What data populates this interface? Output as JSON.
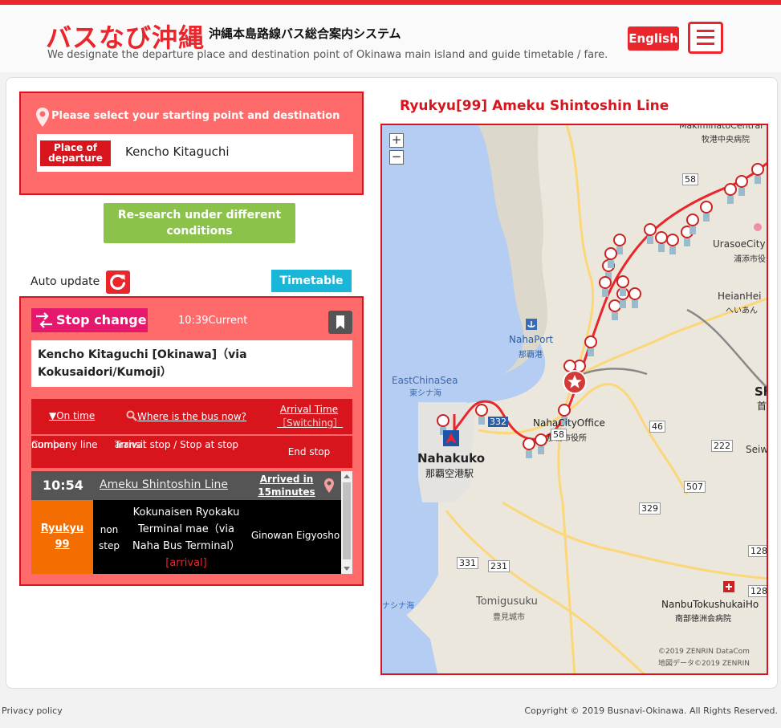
{
  "header": {
    "logo": "バスなび沖縄",
    "subtitle": "沖縄本島路線バス総合案内システム",
    "tagline": "We designate the departure place and destination point of Okinawa main island and guide timetable / fare.",
    "english_label": "English"
  },
  "search": {
    "prompt": "Please select your starting point and destination",
    "departure_tag_line1": "Place of",
    "departure_tag_line2": "departure",
    "departure_value": "Kencho Kitaguchi",
    "research_label_line1": "Re-search under different",
    "research_label_line2": "conditions"
  },
  "controls": {
    "auto_update": "Auto update",
    "timetable": "Timetable"
  },
  "stop": {
    "stop_change": "Stop change",
    "current_time": "10:39Current",
    "name": "Kencho Kitaguchi [Okinawa]（via Kokusaidori/Kumoji）",
    "opt_on_time": "▼On time",
    "opt_where": "Where is the bus now?",
    "opt_arrival": "Arrival Time",
    "opt_switching": "［Switching］",
    "col_company_1": "Company line",
    "col_company_2": "number",
    "col_transit_1": "Transit stop / Stop at stop",
    "col_transit_2": "arrival",
    "col_end": "End stop"
  },
  "bus": {
    "time": "10:54",
    "line": "Ameku Shintoshin Line",
    "arrival_1": "Arrived in",
    "arrival_2": "15minutes",
    "company_1": "Ryukyu",
    "company_2": "99",
    "nonstop_1": "non",
    "nonstop_2": "step",
    "transit_1": "Kokunaisen Ryokaku",
    "transit_2": "Terminal mae（via",
    "transit_3": "Naha Bus Terminal）",
    "transit_4": "[arrival]",
    "end_stop": "Ginowan Eigyosho"
  },
  "map": {
    "route_title": "Ryukyu[99] Ameku Shintoshin Line",
    "zoom_in": "+",
    "zoom_out": "−",
    "labels": {
      "naha_port": "NahaPort",
      "naha_port_jp": "那覇港",
      "east_china_sea": "EastChinaSea",
      "east_china_sea_jp": "東シナ海",
      "naha_city_office": "NahaCityOffice",
      "naha_city_office_jp": "那覇市役所",
      "nahakuko": "Nahakuko",
      "nahakuko_jp": "那覇空港駅",
      "urasoe": "UrasoeCity",
      "urasoe_jp": "浦添市役",
      "heian": "HeianHei",
      "heian_jp": "へいあん",
      "makiminato": "MakiminatoCentral",
      "makiminato_jp": "牧港中央病院",
      "tomigusuku": "Tomigusuku",
      "tomigusuku_jp": "豊見城市",
      "nanbu": "NanbuTokushukaiHo",
      "nanbu_jp": "南部徳洲会病院",
      "china_sea_bottom": "ナシナ海",
      "seiwa": "Seiw",
      "sh": "Sh",
      "sh_jp": "首",
      "copyright_1": "©2019 ZENRIN DataCom",
      "copyright_2": "地図データ©2019 ZENRIN"
    },
    "road_numbers": [
      "58",
      "58",
      "332",
      "46",
      "222",
      "507",
      "329",
      "331",
      "231",
      "128",
      "128"
    ]
  },
  "footer": {
    "privacy": "Privacy policy",
    "copyright": "Copyright © 2019 Busnavi-Okinawa. All Rights Reserved."
  },
  "colors": {
    "brand_red": "#e8262b",
    "panel_red": "#ff6b6b",
    "research_green": "#8bc34a",
    "timetable_cyan": "#1ab6d8",
    "stop_change_pink": "#e6186d",
    "company_orange": "#f46d00"
  }
}
